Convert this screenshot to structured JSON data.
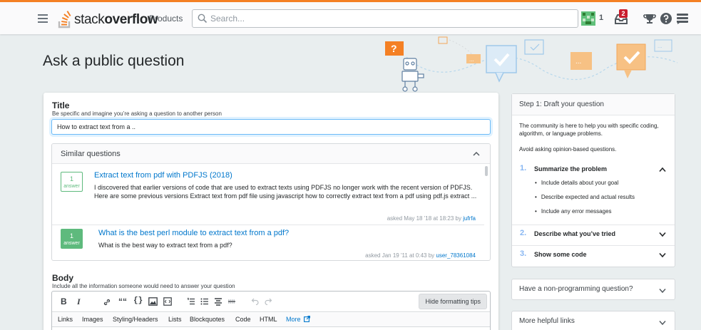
{
  "colors": {
    "accent": "#f48024",
    "link": "#0077cc",
    "answer_green": "#5eba7d",
    "page_bg": "#e9eeef"
  },
  "topbar": {
    "menu_icon": "hamburger-icon",
    "logo_text_regular": "stack",
    "logo_text_bold": "overflow",
    "products_label": "Products",
    "search_placeholder": "Search...",
    "reputation": "1",
    "inbox_count": "2",
    "icons": [
      "hamburger-icon",
      "search-icon",
      "inbox-icon",
      "trophy-icon",
      "help-icon",
      "site-switcher-icon"
    ]
  },
  "header": {
    "title": "Ask a public question"
  },
  "title_section": {
    "label": "Title",
    "hint": "Be specific and imagine you’re asking a question to another person",
    "value": "How to extract text from a .."
  },
  "similar": {
    "heading": "Similar questions",
    "items": [
      {
        "answers": "1",
        "answers_label": "answer",
        "accepted": false,
        "title": "Extract text from pdf with PDFJS (2018)",
        "excerpt": "I discovered that earlier versions of code that are used to extract texts using PDFJS no longer work with the recent version of PDFJS. Here are some previous versions Extract text from pdf file using javascript how to correctly extract text from a pdf using pdf.js extract ...",
        "asked": "asked May 18 '18 at 18:23 by",
        "user": "jufrfa"
      },
      {
        "answers": "1",
        "answers_label": "answer",
        "accepted": true,
        "title": "What is the best perl module to extract text from a pdf?",
        "excerpt": "What is the best way to extract text from a pdf?",
        "asked": "asked Jan 19 '11 at 0:43 by",
        "user": "user_78361084"
      }
    ]
  },
  "body_section": {
    "label": "Body",
    "hint": "Include all the information someone would need to answer your question",
    "toolbar": {
      "bold": "B",
      "italic": "I",
      "blockquote": "““",
      "code": "{}",
      "hide_tips": "Hide formatting tips"
    },
    "tips": [
      "Links",
      "Images",
      "Styling/Headers",
      "Lists",
      "Blockquotes",
      "Code",
      "HTML"
    ],
    "tips_more": "More"
  },
  "sidebar": {
    "draft_heading": "Step 1: Draft your question",
    "intro": "The community is here to help you with specific coding, algorithm, or language problems.",
    "opinion": "Avoid asking opinion-based questions.",
    "steps": [
      {
        "num": "1.",
        "label": "Summarize the problem",
        "expanded": true,
        "bullets": [
          "Include details about your goal",
          "Describe expected and actual results",
          "Include any error messages"
        ]
      },
      {
        "num": "2.",
        "label": "Describe what you’ve tried",
        "expanded": false
      },
      {
        "num": "3.",
        "label": "Show some code",
        "expanded": false
      }
    ],
    "non_programming": "Have a non-programming question?",
    "helpful_links": "More helpful links"
  }
}
